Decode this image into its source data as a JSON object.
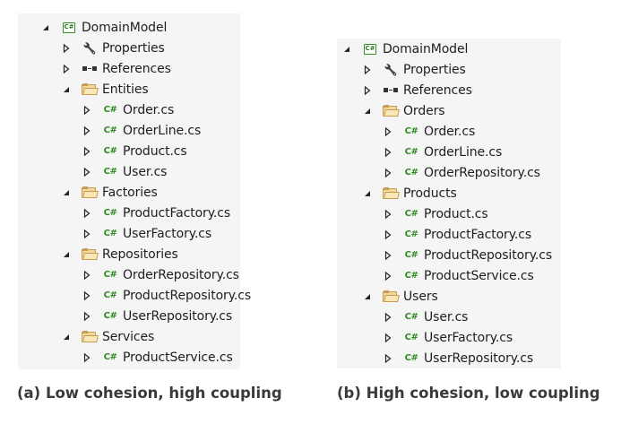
{
  "panels": [
    {
      "id": "a",
      "caption": "(a) Low cohesion, high coupling",
      "tree": [
        {
          "depth": 0,
          "expanded": true,
          "icon": "csharp-project-icon",
          "label": "DomainModel"
        },
        {
          "depth": 1,
          "expanded": false,
          "icon": "wrench-icon",
          "label": "Properties"
        },
        {
          "depth": 1,
          "expanded": false,
          "icon": "references-icon",
          "label": "References"
        },
        {
          "depth": 1,
          "expanded": true,
          "icon": "folder-icon",
          "label": "Entities"
        },
        {
          "depth": 2,
          "expanded": false,
          "icon": "csharp-file-icon",
          "label": "Order.cs"
        },
        {
          "depth": 2,
          "expanded": false,
          "icon": "csharp-file-icon",
          "label": "OrderLine.cs"
        },
        {
          "depth": 2,
          "expanded": false,
          "icon": "csharp-file-icon",
          "label": "Product.cs"
        },
        {
          "depth": 2,
          "expanded": false,
          "icon": "csharp-file-icon",
          "label": "User.cs"
        },
        {
          "depth": 1,
          "expanded": true,
          "icon": "folder-icon",
          "label": "Factories"
        },
        {
          "depth": 2,
          "expanded": false,
          "icon": "csharp-file-icon",
          "label": "ProductFactory.cs"
        },
        {
          "depth": 2,
          "expanded": false,
          "icon": "csharp-file-icon",
          "label": "UserFactory.cs"
        },
        {
          "depth": 1,
          "expanded": true,
          "icon": "folder-icon",
          "label": "Repositories"
        },
        {
          "depth": 2,
          "expanded": false,
          "icon": "csharp-file-icon",
          "label": "OrderRepository.cs"
        },
        {
          "depth": 2,
          "expanded": false,
          "icon": "csharp-file-icon",
          "label": "ProductRepository.cs"
        },
        {
          "depth": 2,
          "expanded": false,
          "icon": "csharp-file-icon",
          "label": "UserRepository.cs"
        },
        {
          "depth": 1,
          "expanded": true,
          "icon": "folder-icon",
          "label": "Services"
        },
        {
          "depth": 2,
          "expanded": false,
          "icon": "csharp-file-icon",
          "label": "ProductService.cs"
        }
      ]
    },
    {
      "id": "b",
      "caption": "(b) High cohesion, low coupling",
      "tree": [
        {
          "depth": 0,
          "expanded": true,
          "icon": "csharp-project-icon",
          "label": "DomainModel"
        },
        {
          "depth": 1,
          "expanded": false,
          "icon": "wrench-icon",
          "label": "Properties"
        },
        {
          "depth": 1,
          "expanded": false,
          "icon": "references-icon",
          "label": "References"
        },
        {
          "depth": 1,
          "expanded": true,
          "icon": "folder-icon",
          "label": "Orders"
        },
        {
          "depth": 2,
          "expanded": false,
          "icon": "csharp-file-icon",
          "label": "Order.cs"
        },
        {
          "depth": 2,
          "expanded": false,
          "icon": "csharp-file-icon",
          "label": "OrderLine.cs"
        },
        {
          "depth": 2,
          "expanded": false,
          "icon": "csharp-file-icon",
          "label": "OrderRepository.cs"
        },
        {
          "depth": 1,
          "expanded": true,
          "icon": "folder-icon",
          "label": "Products"
        },
        {
          "depth": 2,
          "expanded": false,
          "icon": "csharp-file-icon",
          "label": "Product.cs"
        },
        {
          "depth": 2,
          "expanded": false,
          "icon": "csharp-file-icon",
          "label": "ProductFactory.cs"
        },
        {
          "depth": 2,
          "expanded": false,
          "icon": "csharp-file-icon",
          "label": "ProductRepository.cs"
        },
        {
          "depth": 2,
          "expanded": false,
          "icon": "csharp-file-icon",
          "label": "ProductService.cs"
        },
        {
          "depth": 1,
          "expanded": true,
          "icon": "folder-icon",
          "label": "Users"
        },
        {
          "depth": 2,
          "expanded": false,
          "icon": "csharp-file-icon",
          "label": "User.cs"
        },
        {
          "depth": 2,
          "expanded": false,
          "icon": "csharp-file-icon",
          "label": "UserFactory.cs"
        },
        {
          "depth": 2,
          "expanded": false,
          "icon": "csharp-file-icon",
          "label": "UserRepository.cs"
        }
      ]
    }
  ],
  "icon_text": {
    "csharp_file": "C#",
    "csharp_project": "C#"
  },
  "colors": {
    "panel_bg": "#f5f5f5",
    "csharp_green": "#2e8b21",
    "folder": "#f2d79a",
    "text": "#1e1e1e",
    "caption": "#3a3a3a"
  }
}
